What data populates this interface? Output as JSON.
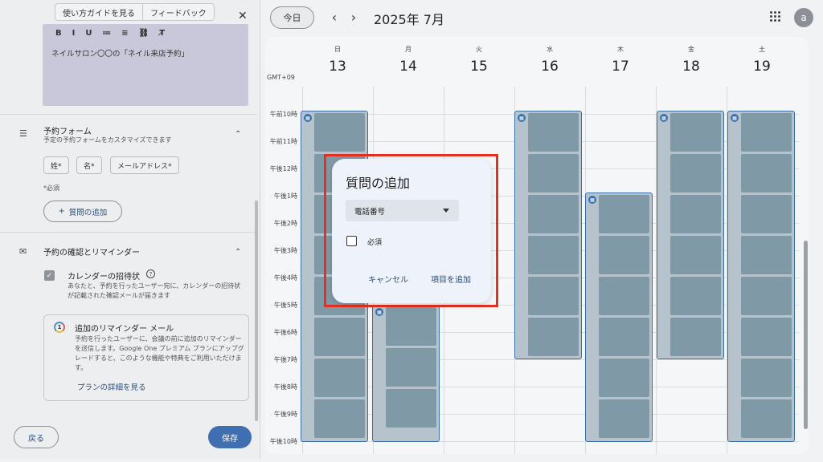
{
  "calendar": {
    "today_label": "今日",
    "prev_icon": "chevron-left-icon",
    "next_icon": "chevron-right-icon",
    "month_title": "2025年 7月",
    "avatar_letter": "a",
    "timezone": "GMT+09",
    "days": [
      {
        "dow": "日",
        "num": "13"
      },
      {
        "dow": "月",
        "num": "14"
      },
      {
        "dow": "火",
        "num": "15"
      },
      {
        "dow": "水",
        "num": "16"
      },
      {
        "dow": "木",
        "num": "17"
      },
      {
        "dow": "金",
        "num": "18"
      },
      {
        "dow": "土",
        "num": "19"
      }
    ],
    "hours": [
      "午前10時",
      "午前11時",
      "午後12時",
      "午後1時",
      "午後2時",
      "午後3時",
      "午後4時",
      "午後5時",
      "午後6時",
      "午後7時",
      "午後8時",
      "午後9時",
      "午後10時"
    ]
  },
  "sidebar": {
    "guide_label": "使い方ガイドを見る",
    "feedback_label": "フィードバック",
    "close_icon": "close-icon",
    "editor_toolbar": [
      "B",
      "I",
      "U",
      "≔",
      "≡",
      "⛓",
      "T̸"
    ],
    "editor_text": "ネイルサロン〇〇の「ネイル来店予約」",
    "form_section": {
      "title": "予約フォーム",
      "subtitle": "予定の予約フォームをカスタマイズできます",
      "chips": [
        "姓*",
        "名*",
        "メールアドレス*"
      ],
      "required_note": "*必須",
      "add_question_label": "質問の追加"
    },
    "confirm_section": {
      "title": "予約の確認とリマインダー",
      "invite_title": "カレンダーの招待状",
      "invite_desc": "あなたと、予約を行ったユーザー宛に、カレンダーの招待状が記載された確認メールが届きます"
    },
    "reminder": {
      "title": "追加のリマインダー メール",
      "desc": "予約を行ったユーザーに、会議の前に追加のリマインダーを送信します。Google One プレミアム プランにアップグレードすると、このような機能や特典をご利用いただけます。",
      "link": "プランの詳細を見る"
    },
    "back_label": "戻る",
    "save_label": "保存"
  },
  "dialog": {
    "title": "質問の追加",
    "select_value": "電話番号",
    "required_label": "必須",
    "required_checked": false,
    "cancel_label": "キャンセル",
    "add_label": "項目を追加"
  },
  "colors": {
    "accent": "#3f6fb0",
    "highlight": "#e53021"
  }
}
